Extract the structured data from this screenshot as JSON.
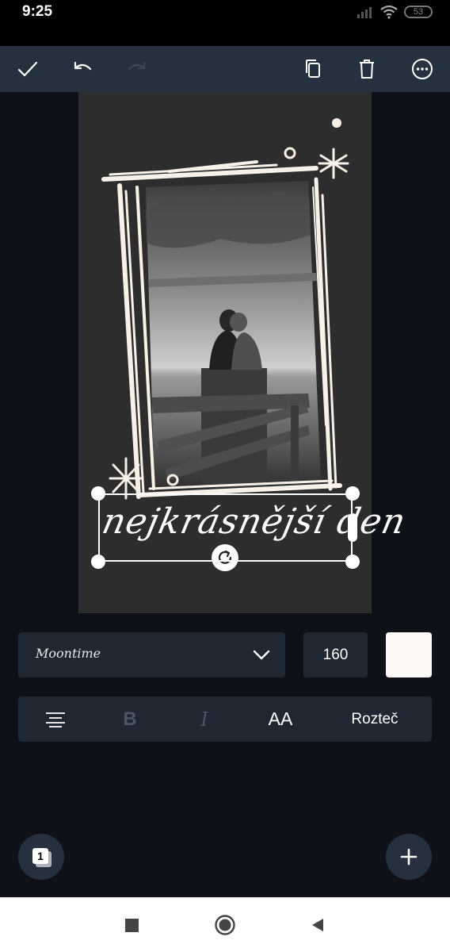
{
  "status_bar": {
    "time": "9:25",
    "battery": "53"
  },
  "toolbar": {
    "done_icon": "check-icon",
    "undo_icon": "undo-icon",
    "redo_icon": "redo-icon",
    "duplicate_icon": "copy-icon",
    "delete_icon": "trash-icon",
    "more_icon": "more-icon"
  },
  "canvas": {
    "text_element": "nejkrásnější den",
    "background_color": "#2d2d2d",
    "frame_color": "#f7f1e8"
  },
  "text_controls": {
    "font_name": "Moontime",
    "font_size": "160",
    "text_color": "#fdf9f4"
  },
  "format_bar": {
    "align_icon": "align-center-icon",
    "bold": "B",
    "italic": "I",
    "case": "AA",
    "spacing": "Rozteč"
  },
  "bottom": {
    "page_count": "1",
    "add_icon": "plus-icon"
  },
  "nav_bar": {
    "recents_icon": "square-icon",
    "home_icon": "circle-icon",
    "back_icon": "triangle-back-icon"
  }
}
